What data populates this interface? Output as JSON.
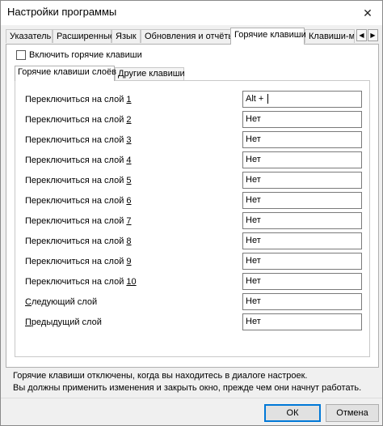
{
  "window": {
    "title": "Настройки программы",
    "close_glyph": "✕"
  },
  "tabs": [
    {
      "label": "Указатель"
    },
    {
      "label": "Расширенные"
    },
    {
      "label": "Язык"
    },
    {
      "label": "Обновления и отчёты"
    },
    {
      "label": "Горячие клавиши"
    },
    {
      "label": "Клавиши-мо"
    }
  ],
  "tab_scroll": {
    "left": "◀",
    "right": "▶"
  },
  "enable_hotkeys": {
    "label": "Включить горячие клавиши",
    "checked": false
  },
  "subtabs": [
    {
      "label": "Горячие клавиши слоёв"
    },
    {
      "label": "Другие клавиши"
    }
  ],
  "rows": [
    {
      "label_prefix": "Переключиться на слой ",
      "label_accel": "1",
      "value": "Alt + "
    },
    {
      "label_prefix": "Переключиться на слой ",
      "label_accel": "2",
      "value": "Нет"
    },
    {
      "label_prefix": "Переключиться на слой ",
      "label_accel": "3",
      "value": "Нет"
    },
    {
      "label_prefix": "Переключиться на слой ",
      "label_accel": "4",
      "value": "Нет"
    },
    {
      "label_prefix": "Переключиться на слой ",
      "label_accel": "5",
      "value": "Нет"
    },
    {
      "label_prefix": "Переключиться на слой ",
      "label_accel": "6",
      "value": "Нет"
    },
    {
      "label_prefix": "Переключиться на слой ",
      "label_accel": "7",
      "value": "Нет"
    },
    {
      "label_prefix": "Переключиться на слой ",
      "label_accel": "8",
      "value": "Нет"
    },
    {
      "label_prefix": "Переключиться на слой ",
      "label_accel": "9",
      "value": "Нет"
    },
    {
      "label_prefix": "Переключиться на слой ",
      "label_accel": "10",
      "value": "Нет"
    },
    {
      "label_prefix": "",
      "label_accel": "С",
      "label_suffix": "ледующий слой",
      "value": "Нет"
    },
    {
      "label_prefix": "",
      "label_accel": "П",
      "label_suffix": "редыдущий слой",
      "value": "Нет"
    }
  ],
  "info": {
    "line1": "Горячие клавиши отключены, когда вы находитесь в диалоге настроек.",
    "line2": "Вы должны применить изменения и закрыть окно, прежде чем они начнут работать."
  },
  "buttons": {
    "ok": "ОК",
    "cancel": "Отмена"
  }
}
